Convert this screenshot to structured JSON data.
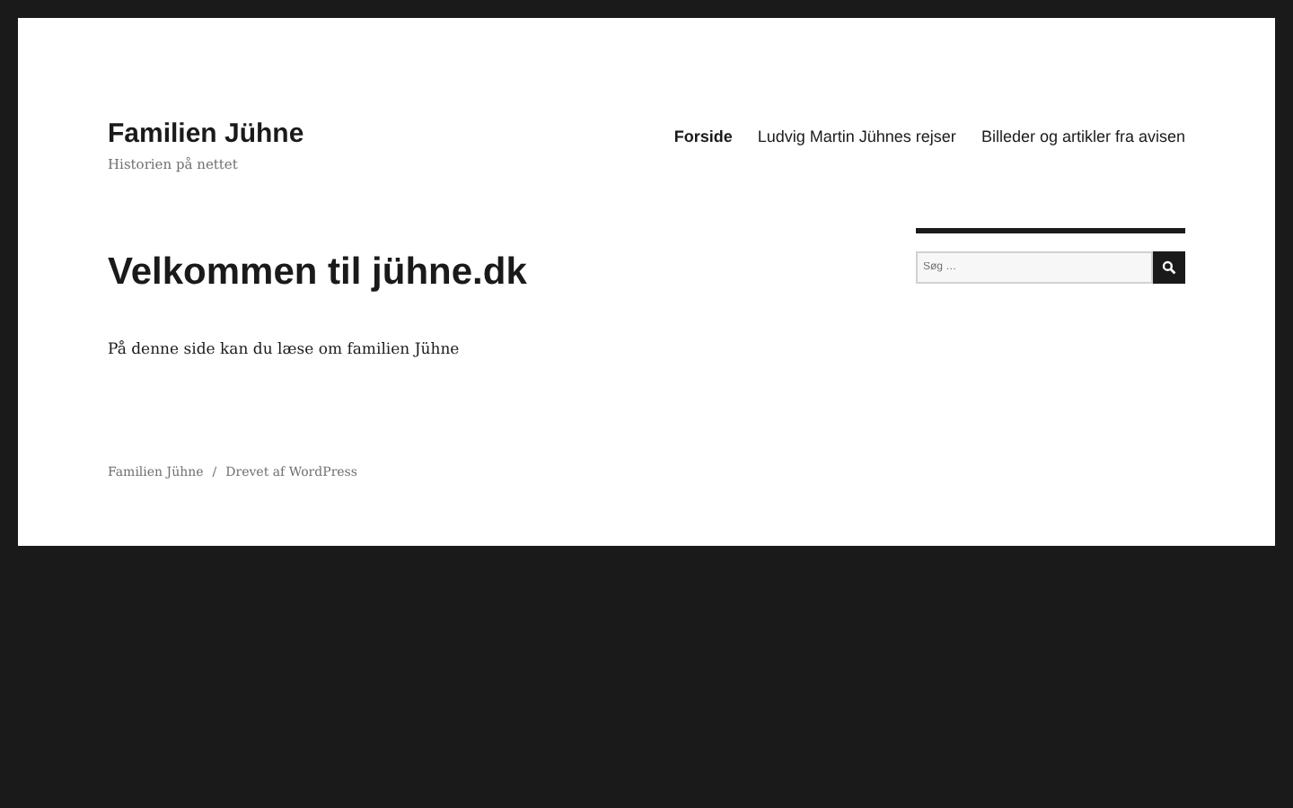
{
  "site": {
    "title": "Familien Jühne",
    "tagline": "Historien på nettet"
  },
  "nav": [
    {
      "label": "Forside",
      "selected": true
    },
    {
      "label": "Ludvig Martin Jühnes rejser",
      "selected": false
    },
    {
      "label": "Billeder og artikler fra avisen",
      "selected": false
    }
  ],
  "page": {
    "title": "Velkommen til jühne.dk",
    "body": "På denne side kan du læse om familien Jühne"
  },
  "search": {
    "placeholder": "Søg …"
  },
  "footer": {
    "site_link": "Familien Jühne",
    "separator": "/",
    "credit": "Drevet af WordPress"
  }
}
